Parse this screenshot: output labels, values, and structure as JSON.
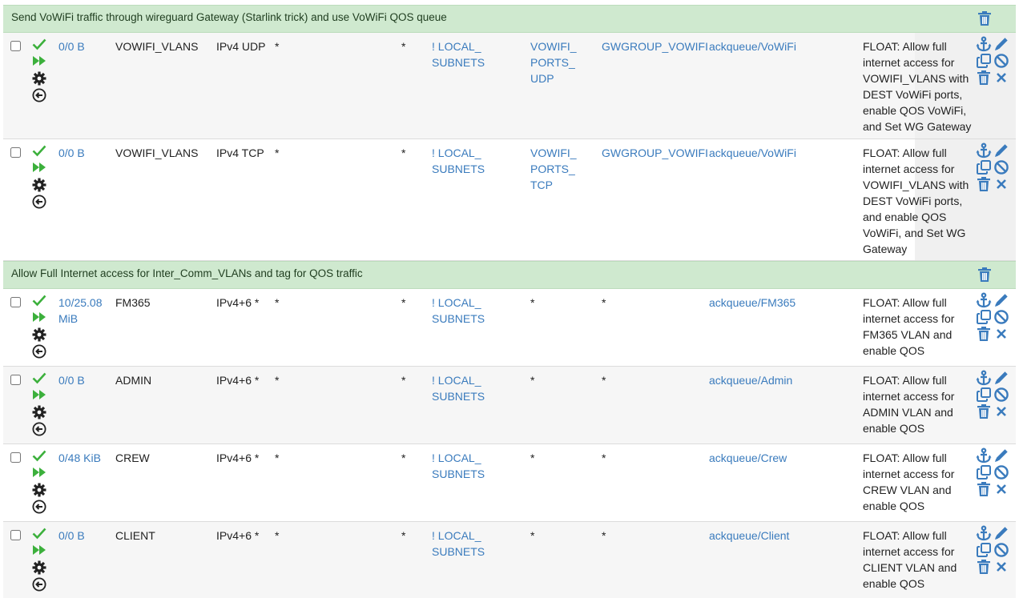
{
  "colors": {
    "separator_bg": "#cfe9cf",
    "link": "#3a7bbd",
    "check_green": "#3cb03c",
    "icon_blue": "#3a7bbd",
    "icon_dark": "#222222"
  },
  "groups": [
    {
      "title": "Send VoWiFi traffic through wireguard Gateway (Starlink trick) and use VoWiFi QOS queue",
      "rules": [
        {
          "states": "0/0 B",
          "protocol": "IPv4 UDP",
          "source": "VOWIFI_VLANS",
          "source_port": "*",
          "destination_l1": "! LOCAL_",
          "destination_l2": "SUBNETS",
          "dest_port_l1": "VOWIFI_",
          "dest_port_l2": "PORTS_",
          "dest_port_l3": "UDP",
          "gateway": "GWGROUP_VOWIFI",
          "queue_l1": "ackqueue/VoWiFi",
          "queue_l2": "",
          "desc": [
            "FLOAT: Allow full",
            "internet access for",
            "VOWIFI_VLANS with",
            "DEST VoWiFi ports,",
            "enable QOS VoWiFi,",
            "and Set WG Gateway"
          ]
        },
        {
          "states": "0/0 B",
          "protocol": "IPv4 TCP",
          "source": "VOWIFI_VLANS",
          "source_port": "*",
          "destination_l1": "! LOCAL_",
          "destination_l2": "SUBNETS",
          "dest_port_l1": "VOWIFI_",
          "dest_port_l2": "PORTS_",
          "dest_port_l3": "TCP",
          "gateway": "GWGROUP_VOWIFI",
          "queue_l1": "ackqueue/VoWiFi",
          "queue_l2": "",
          "desc": [
            "FLOAT: Allow full",
            "internet access for",
            "VOWIFI_VLANS with",
            "DEST VoWiFi ports,",
            "and enable QOS",
            "VoWiFi, and Set WG",
            "Gateway"
          ]
        }
      ]
    },
    {
      "title": "Allow Full Internet access for Inter_Comm_VLANs and tag for QOS traffic",
      "rules": [
        {
          "states_l1": "10/25.08",
          "states_l2": "MiB",
          "protocol": "IPv4+6 *",
          "source": "FM365",
          "source_port": "*",
          "destination_l1": "! LOCAL_",
          "destination_l2": "SUBNETS",
          "dest_port": "*",
          "gateway": "*",
          "queue_l1": "ackqueue/FM365",
          "desc": [
            "FLOAT: Allow full",
            "internet access for",
            "FM365 VLAN and",
            "enable QOS"
          ]
        },
        {
          "states": "0/0 B",
          "protocol": "IPv4+6 *",
          "source": "ADMIN",
          "source_port": "*",
          "destination_l1": "! LOCAL_",
          "destination_l2": "SUBNETS",
          "dest_port": "*",
          "gateway": "*",
          "queue_l1": "ackqueue/Admin",
          "desc": [
            "FLOAT: Allow full",
            "internet access for",
            "ADMIN VLAN and",
            "enable QOS"
          ]
        },
        {
          "states": "0/48 KiB",
          "protocol": "IPv4+6 *",
          "source": "CREW",
          "source_port": "*",
          "destination_l1": "! LOCAL_",
          "destination_l2": "SUBNETS",
          "dest_port": "*",
          "gateway": "*",
          "queue_l1": "ackqueue/Crew",
          "desc": [
            "FLOAT: Allow full",
            "internet access for",
            "CREW VLAN and",
            "enable QOS"
          ]
        },
        {
          "states": "0/0 B",
          "protocol": "IPv4+6 *",
          "source": "CLIENT",
          "source_port": "*",
          "destination_l1": "! LOCAL_",
          "destination_l2": "SUBNETS",
          "dest_port": "*",
          "gateway": "*",
          "queue_l1": "ackqueue/Client",
          "desc": [
            "FLOAT: Allow full",
            "internet access for",
            "CLIENT VLAN and",
            "enable QOS"
          ]
        }
      ]
    }
  ],
  "icons": {
    "status": [
      "check-icon",
      "fast-forward-icon",
      "gear-icon",
      "back-arrow-icon"
    ],
    "actions": [
      "anchor-icon",
      "edit-pencil-icon",
      "copy-icon",
      "disable-icon",
      "trash-icon",
      "delete-x-icon"
    ]
  }
}
